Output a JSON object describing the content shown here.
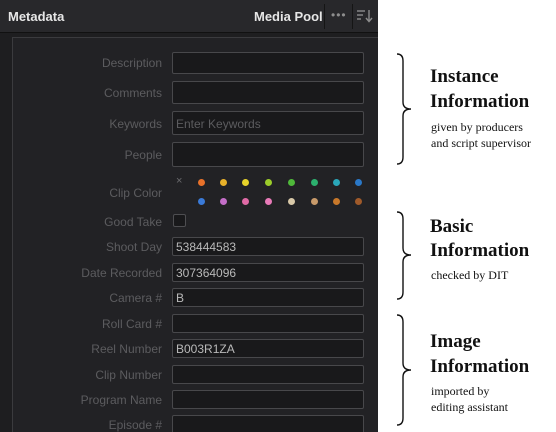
{
  "panel": {
    "title": "Metadata",
    "media_pool_label": "Media Pool",
    "more_label": "•••"
  },
  "fields": {
    "description": {
      "label": "Description",
      "value": ""
    },
    "comments": {
      "label": "Comments",
      "value": ""
    },
    "keywords": {
      "label": "Keywords",
      "value": "",
      "placeholder": "Enter Keywords"
    },
    "people": {
      "label": "People",
      "value": ""
    },
    "clip_color": {
      "label": "Clip Color",
      "clear_symbol": "×"
    },
    "good_take": {
      "label": "Good Take",
      "checked": false
    },
    "shoot_day": {
      "label": "Shoot Day",
      "value": "538444583"
    },
    "date_recorded": {
      "label": "Date Recorded",
      "value": "307364096"
    },
    "camera": {
      "label": "Camera #",
      "value": "B"
    },
    "roll_card": {
      "label": "Roll Card #",
      "value": ""
    },
    "reel_number": {
      "label": "Reel Number",
      "value": "B003R1ZA"
    },
    "clip_number": {
      "label": "Clip Number",
      "value": ""
    },
    "program_name": {
      "label": "Program Name",
      "value": ""
    },
    "episode": {
      "label": "Episode #",
      "value": ""
    }
  },
  "clip_colors": {
    "row1": [
      "#e8712a",
      "#e8b12a",
      "#e6d22a",
      "#9bcc2a",
      "#4fb83a",
      "#2cb06e",
      "#2aa6b8",
      "#2a78c8"
    ],
    "row2": [
      "#3a7ad8",
      "#c46ec8",
      "#e06aa6",
      "#e87ab8",
      "#d8c8a8",
      "#c89a6a",
      "#c8782a",
      "#a05a2a"
    ]
  },
  "annotations": [
    {
      "title_line1": "Instance",
      "title_line2": "Information",
      "sub_line1": "given by producers",
      "sub_line2": "and script supervisor"
    },
    {
      "title_line1": "Basic",
      "title_line2": "Information",
      "sub_line1": "checked by DIT",
      "sub_line2": ""
    },
    {
      "title_line1": "Image",
      "title_line2": "Information",
      "sub_line1": "imported by",
      "sub_line2": "editing assistant"
    }
  ]
}
